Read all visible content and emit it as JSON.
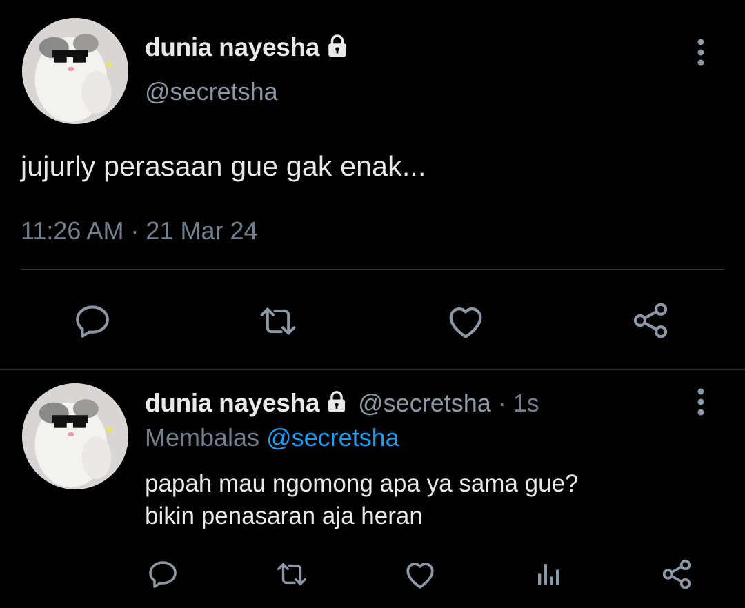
{
  "tweet": {
    "author": {
      "display_name": "dunia nayesha",
      "handle": "@secretsha",
      "protected": true
    },
    "text": "jujurly perasaan gue gak enak...",
    "timestamp": "11:26 AM · 21 Mar 24",
    "actions": [
      "reply-icon",
      "retweet-icon",
      "like-icon",
      "share-icon"
    ]
  },
  "reply": {
    "author": {
      "display_name": "dunia nayesha",
      "handle": "@secretsha",
      "protected": true
    },
    "time_ago": "· 1s",
    "replying_to_label": "Membalas",
    "replying_to_handle": "@secretsha",
    "text_lines": [
      "papah mau ngomong apa ya sama gue?",
      "bikin penasaran aja heran"
    ],
    "actions": [
      "reply-icon",
      "retweet-icon",
      "like-icon",
      "analytics-icon",
      "share-icon"
    ]
  },
  "colors": {
    "background": "#000000",
    "text_primary": "#e7e9ea",
    "text_secondary": "#71808f",
    "mention": "#1d9bf0",
    "icon": "#8b98a5"
  }
}
